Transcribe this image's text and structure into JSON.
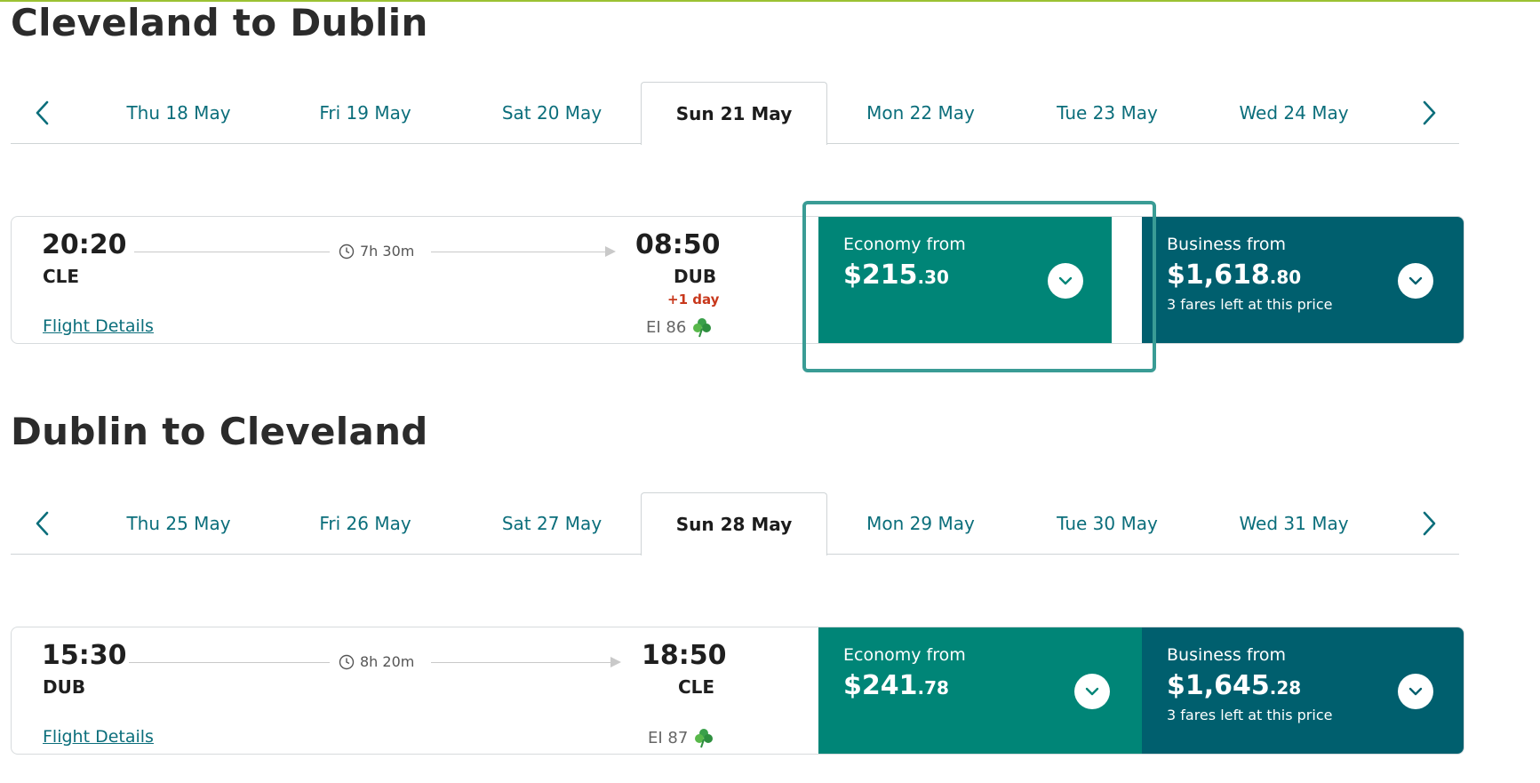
{
  "outbound": {
    "title": "Cleveland to Dublin",
    "dates": [
      "Thu 18 May",
      "Fri 19 May",
      "Sat 20 May",
      "Sun 21 May",
      "Mon 22 May",
      "Tue 23 May",
      "Wed 24 May"
    ],
    "selected_date": "Sun 21 May",
    "flight": {
      "depart_time": "20:20",
      "depart_airport": "CLE",
      "duration": "7h 30m",
      "arrive_time": "08:50",
      "arrive_airport": "DUB",
      "day_offset": "+1 day",
      "details_label": "Flight Details",
      "flight_number": "EI 86",
      "economy": {
        "label": "Economy from",
        "price_main": "$215",
        "price_cents": ".30"
      },
      "business": {
        "label": "Business from",
        "price_main": "$1,618",
        "price_cents": ".80",
        "note": "3 fares left at this price"
      }
    }
  },
  "return": {
    "title": "Dublin to Cleveland",
    "dates": [
      "Thu 25 May",
      "Fri 26 May",
      "Sat 27 May",
      "Sun 28 May",
      "Mon 29 May",
      "Tue 30 May",
      "Wed 31 May"
    ],
    "selected_date": "Sun 28 May",
    "flight": {
      "depart_time": "15:30",
      "depart_airport": "DUB",
      "duration": "8h 20m",
      "arrive_time": "18:50",
      "arrive_airport": "CLE",
      "details_label": "Flight Details",
      "flight_number": "EI 87",
      "economy": {
        "label": "Economy from",
        "price_main": "$241",
        "price_cents": ".78"
      },
      "business": {
        "label": "Business from",
        "price_main": "$1,645",
        "price_cents": ".28",
        "note": "3 fares left at this price"
      }
    }
  },
  "colors": {
    "economy": "#008577",
    "business": "#005f6e",
    "link": "#0b6e7b",
    "day_offset": "#c8381c",
    "selection_outline": "#3a9c95"
  },
  "icons": [
    "chevron-left-icon",
    "chevron-right-icon",
    "clock-icon",
    "shamrock-icon",
    "chevron-down-icon"
  ]
}
